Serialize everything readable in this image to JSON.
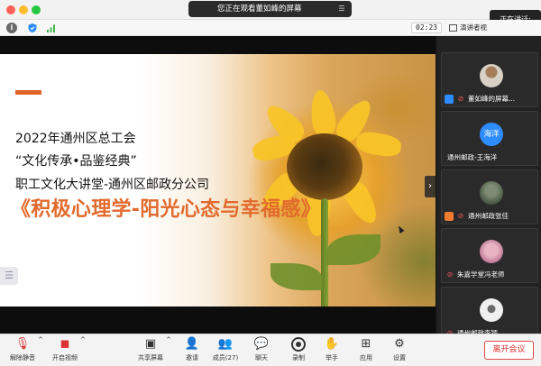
{
  "window": {
    "viewing_label": "您正在观看董如峰的屏幕",
    "speaker_label": "正在讲话:"
  },
  "infobar": {
    "timer": "02:23",
    "view_label": "演讲者视"
  },
  "slide": {
    "line1": "2022年通州区总工会",
    "line2": "“文化传承•品鉴经典”",
    "line3": "职工文化大讲堂-通州区邮政分公司",
    "title": "《积极心理学-阳光心态与幸福感》",
    "accent_color": "#e0642a",
    "title_color": "#e26a2c"
  },
  "gallery": [
    {
      "name": "董如峰的屏幕...",
      "avatar": "tree",
      "avatar_text": ""
    },
    {
      "name": "通州邮政-王海洋",
      "avatar": "blue",
      "avatar_text": "海洋"
    },
    {
      "name": "通州邮政张佳",
      "avatar": "photo",
      "avatar_text": ""
    },
    {
      "name": "朱嘉学堂冯老师",
      "avatar": "pink",
      "avatar_text": ""
    },
    {
      "name": "通州邮政李颖",
      "avatar": "white",
      "avatar_text": ""
    }
  ],
  "toolbar": {
    "unmute": "解除静音",
    "start_video": "开启视频",
    "share_screen": "共享屏幕",
    "invite": "邀请",
    "participants": "成员(27)",
    "chat": "聊天",
    "record": "录制",
    "raise_hand": "举手",
    "apps": "应用",
    "settings": "设置",
    "leave": "离开会议",
    "leave_color": "#e03030"
  }
}
